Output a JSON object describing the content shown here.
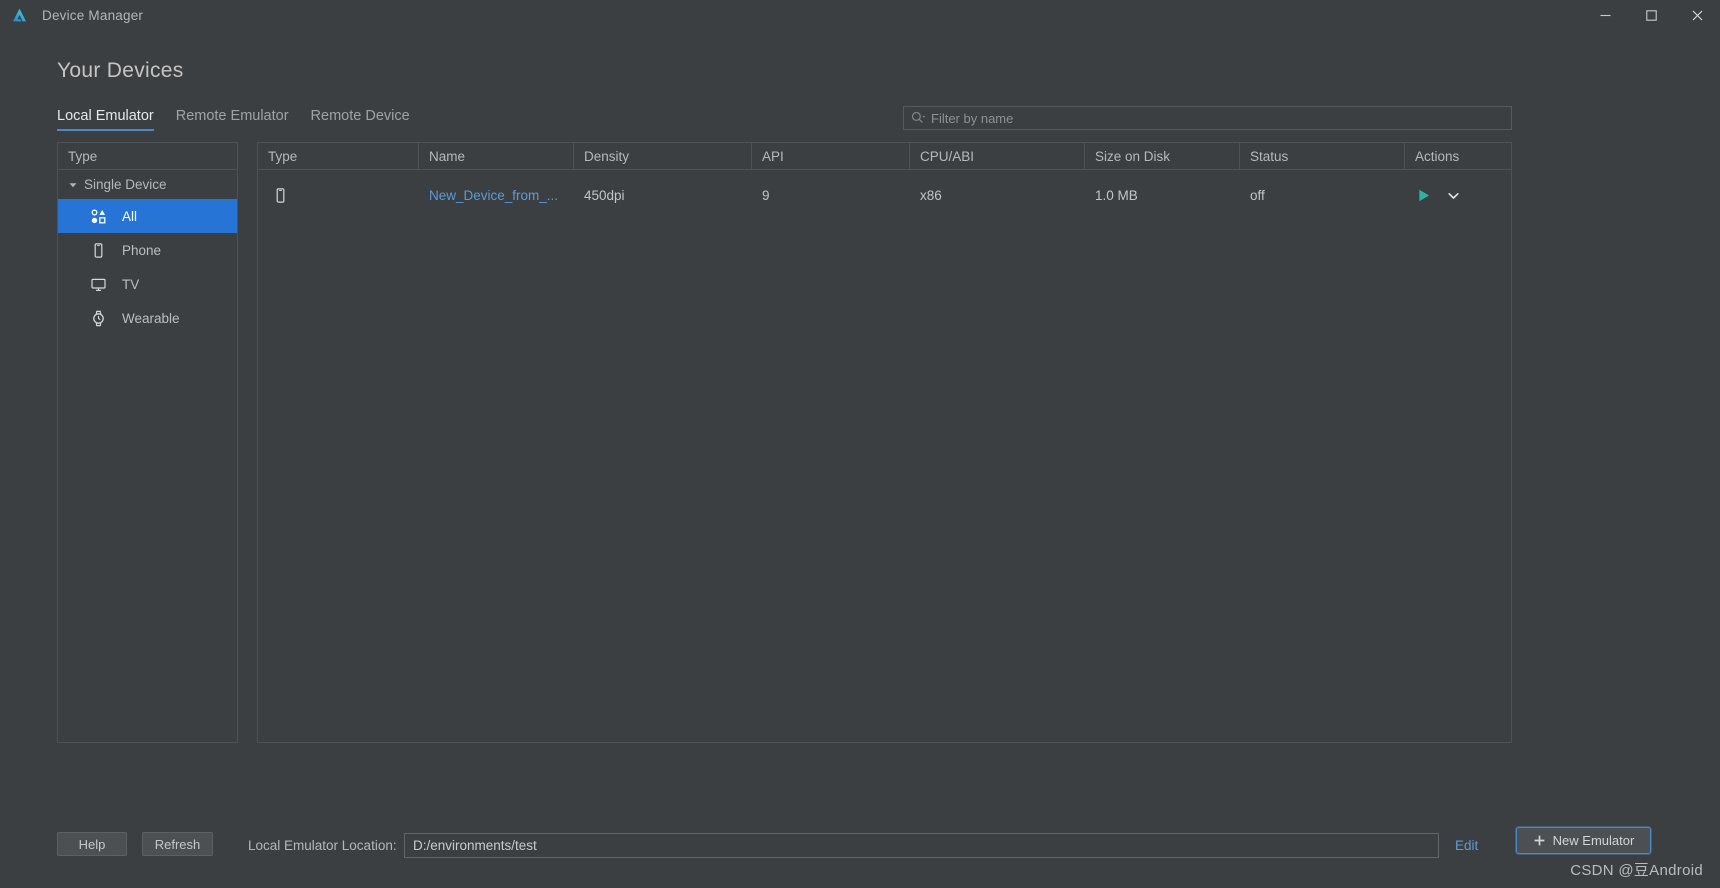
{
  "window": {
    "title": "Device Manager",
    "logo_icon": "android-studio-logo-icon",
    "minimize_icon": "minimize-icon",
    "maximize_icon": "maximize-icon",
    "close_icon": "close-icon"
  },
  "page": {
    "title": "Your Devices"
  },
  "tabs": [
    {
      "label": "Local Emulator",
      "active": true
    },
    {
      "label": "Remote Emulator",
      "active": false
    },
    {
      "label": "Remote Device",
      "active": false
    }
  ],
  "filter": {
    "icon": "search-icon",
    "value": "",
    "placeholder": "Filter by name"
  },
  "sidebar": {
    "header": "Type",
    "group": {
      "label": "Single Device",
      "expanded": true,
      "twisty_icon": "caret-down-icon"
    },
    "items": [
      {
        "label": "All",
        "icon": "shapes-grid-icon",
        "selected": true
      },
      {
        "label": "Phone",
        "icon": "phone-icon",
        "selected": false
      },
      {
        "label": "TV",
        "icon": "tv-icon",
        "selected": false
      },
      {
        "label": "Wearable",
        "icon": "watch-icon",
        "selected": false
      }
    ]
  },
  "table": {
    "columns": [
      "Type",
      "Name",
      "Density",
      "API",
      "CPU/ABI",
      "Size on Disk",
      "Status",
      "Actions"
    ],
    "rows": [
      {
        "type_icon": "phone-icon",
        "name": "New_Device_from_...",
        "density": "450dpi",
        "api": "9",
        "cpu_abi": "x86",
        "size_on_disk": "1.0 MB",
        "status": "off",
        "actions": [
          "play-icon",
          "chevron-down-icon"
        ]
      }
    ]
  },
  "footer": {
    "help_label": "Help",
    "refresh_label": "Refresh",
    "location_label": "Local Emulator Location:",
    "location_value": "D:/environments/test",
    "edit_label": "Edit",
    "new_emulator_label": "New Emulator",
    "new_emulator_icon": "plus-icon"
  },
  "watermark": "CSDN @豆Android",
  "colors": {
    "background": "#3c3f41",
    "selection": "#2675d6",
    "link": "#5a9bd8",
    "accent_border": "#4a88c7",
    "play_green": "#2eb2a4"
  }
}
